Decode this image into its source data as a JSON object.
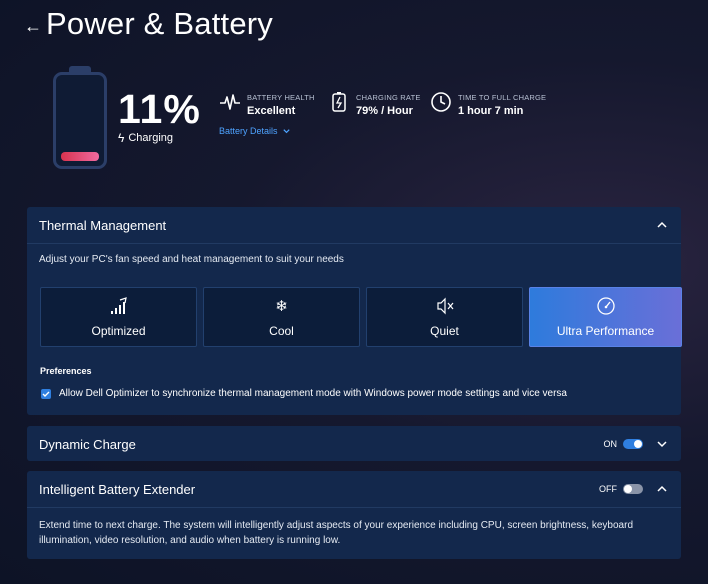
{
  "header": {
    "title": "Power & Battery"
  },
  "battery": {
    "percent": "11%",
    "charge_level": 0.11,
    "status": "Charging",
    "fill_colors": [
      "#d8334f",
      "#f06aa0"
    ]
  },
  "stats": [
    {
      "icon": "heartbeat-icon",
      "caption": "BATTERY HEALTH",
      "value": "Excellent"
    },
    {
      "icon": "charging-battery-icon",
      "caption": "CHARGING RATE",
      "value": "79% / Hour"
    },
    {
      "icon": "clock-icon",
      "caption": "TIME TO FULL CHARGE",
      "value": "1 hour 7 min"
    }
  ],
  "battery_details_link": "Battery Details",
  "thermal": {
    "title": "Thermal Management",
    "description": "Adjust your PC's fan speed and heat management to suit your needs",
    "modes": [
      {
        "label": "Optimized",
        "icon": "signal-bars-icon",
        "active": false
      },
      {
        "label": "Cool",
        "icon": "snowflake-icon",
        "active": false
      },
      {
        "label": "Quiet",
        "icon": "mute-speaker-icon",
        "active": false
      },
      {
        "label": "Ultra Performance",
        "icon": "speedometer-icon",
        "active": true
      }
    ],
    "preferences_title": "Preferences",
    "preference_text": "Allow Dell Optimizer to synchronize thermal management mode with Windows power mode settings and vice versa",
    "preference_checked": true
  },
  "dynamic_charge": {
    "title": "Dynamic Charge",
    "state": "ON"
  },
  "extender": {
    "title": "Intelligent Battery Extender",
    "state": "OFF",
    "description": "Extend time to next charge. The system will intelligently adjust aspects of your experience including CPU, screen brightness, keyboard illumination, video resolution, and audio when battery is running low."
  },
  "colors": {
    "accent": "#2f7fe0",
    "link": "#4ea3ff",
    "panel": "#13284c"
  }
}
